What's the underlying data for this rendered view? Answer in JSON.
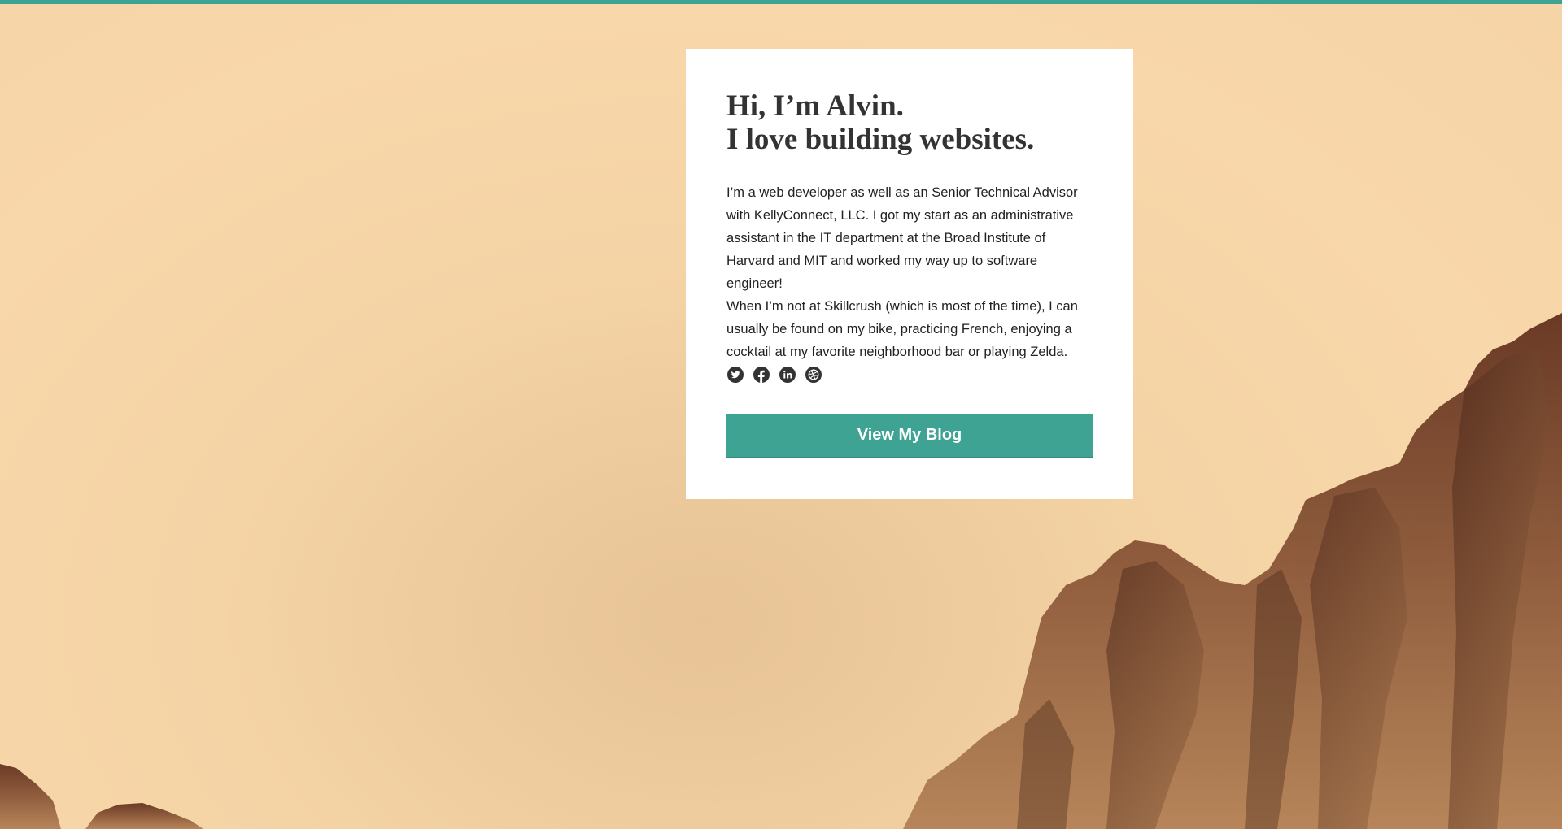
{
  "colors": {
    "accent": "#3fa394",
    "background": "#f8d7aa",
    "card": "#ffffff",
    "heading": "#333333",
    "text": "#222222"
  },
  "intro": {
    "heading_line1": "Hi, I’m Alvin.",
    "heading_line2": "I love building websites.",
    "paragraph1": "I’m a web developer as well as an Senior Technical Advisor with KellyConnect, LLC. I got my start as an administrative assistant in the IT department at the Broad Institute of Harvard and MIT and worked my way up to software engineer!",
    "paragraph2": "When I’m not at Skillcrush (which is most of the time), I can usually be found on my bike, practicing French, enjoying a cocktail at my favorite neighborhood bar or playing Zelda."
  },
  "social": {
    "icons": [
      "twitter-icon",
      "facebook-icon",
      "linkedin-icon",
      "dribbble-icon"
    ]
  },
  "cta": {
    "label": "View My Blog"
  }
}
